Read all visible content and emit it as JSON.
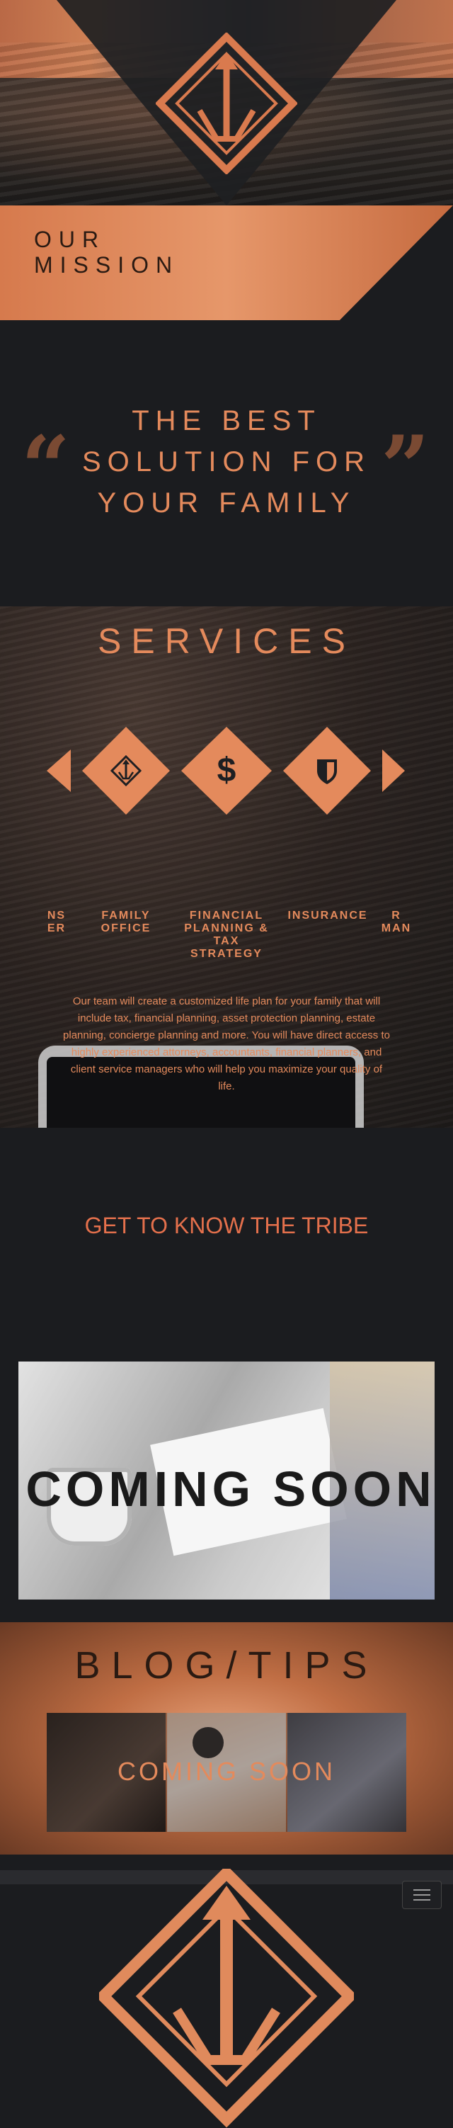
{
  "hero": {
    "logo": "logo-mark"
  },
  "mission": {
    "label_line1": "OUR",
    "label_line2": "MISSION"
  },
  "quote": {
    "line1": "THE BEST",
    "line2": "SOLUTION FOR",
    "line3": "YOUR FAMILY",
    "open_mark": "“",
    "close_mark": "”"
  },
  "services": {
    "title": "SERVICES",
    "icons": [
      "logo-icon",
      "dollar-icon",
      "shield-icon"
    ],
    "labels": [
      {
        "line1": "NS",
        "line2": "ER"
      },
      {
        "line1": "FAMILY",
        "line2": "OFFICE"
      },
      {
        "line1": "FINANCIAL",
        "line2": "PLANNING &",
        "line3": "TAX",
        "line4": "STRATEGY"
      },
      {
        "line1": "INSURANCE"
      },
      {
        "line1": "R",
        "line2": "MAN"
      }
    ],
    "description": "Our team will create a customized life plan for your family that will include tax, financial planning, asset protection planning, estate planning, concierge planning and more. You will have direct access to highly experienced attorneys, accountants, financial planners, and client service managers who will help you maximize your quality of life."
  },
  "tribe": {
    "heading": "GET TO KNOW THE TRIBE"
  },
  "coming": {
    "text": "COMING SOON"
  },
  "blog": {
    "title": "BLOG/TIPS",
    "coming": "COMING SOON"
  },
  "footer": {
    "menu_icon": "hamburger-icon"
  },
  "colors": {
    "accent": "#e48a5c",
    "bg": "#1b1c1f",
    "copper": "#c9784c"
  }
}
